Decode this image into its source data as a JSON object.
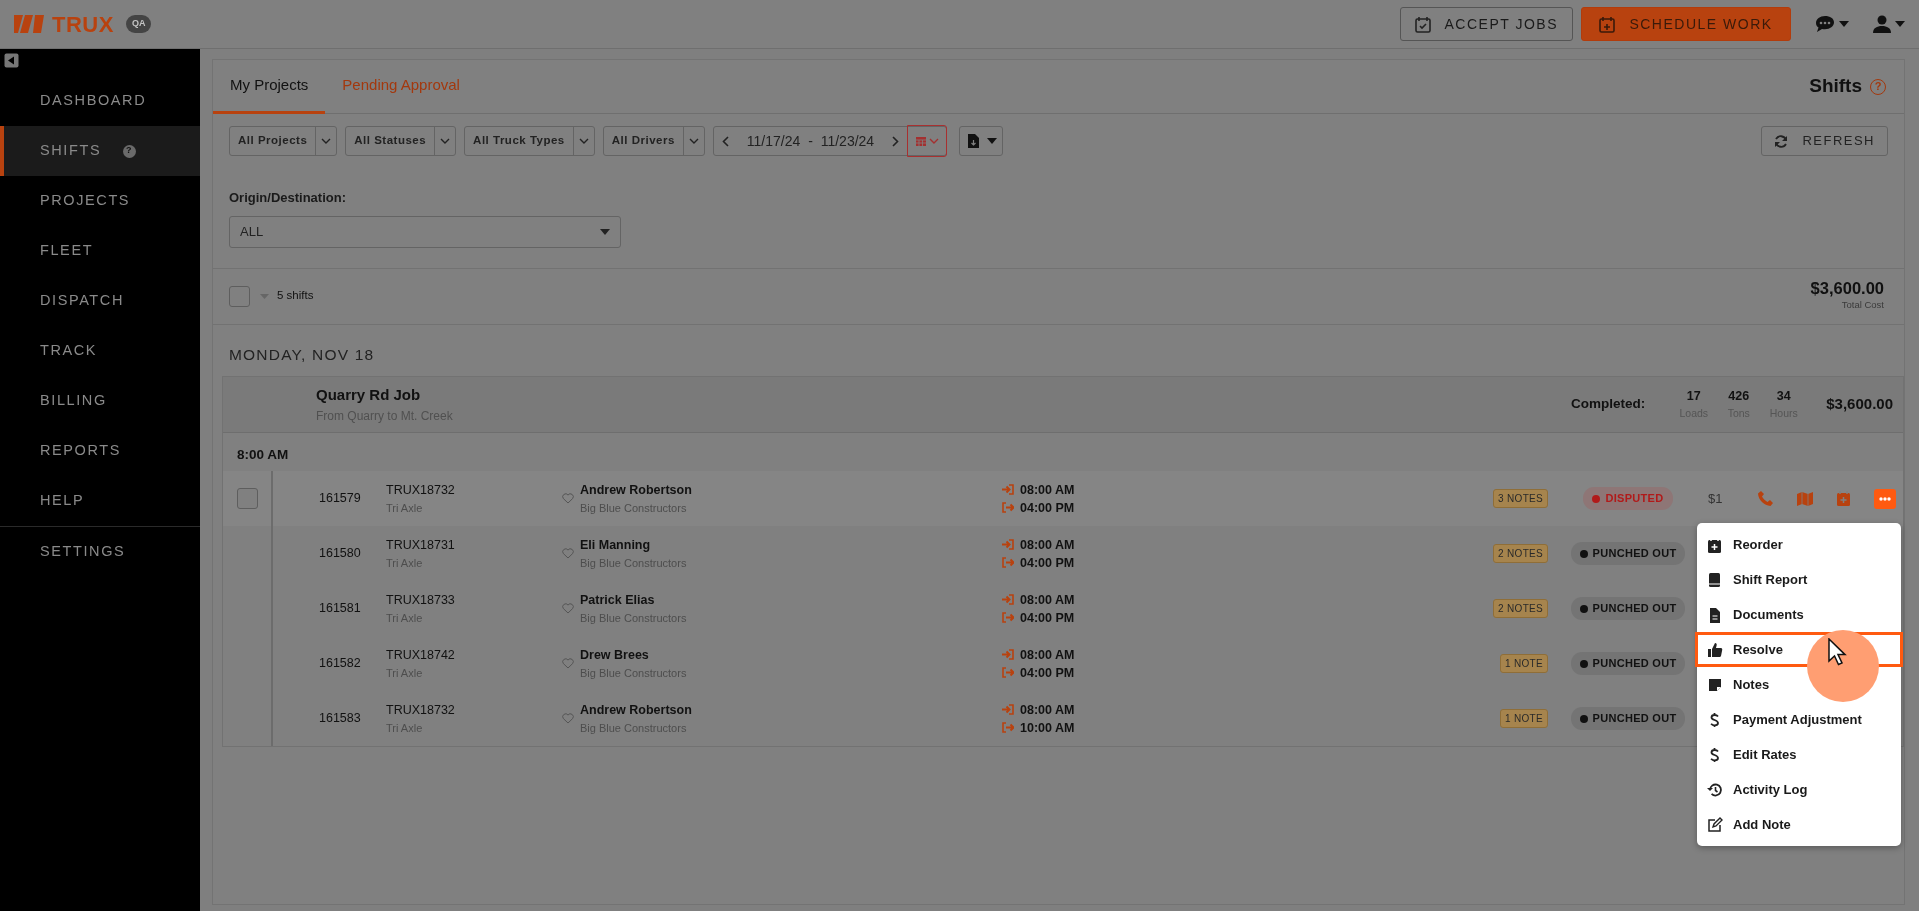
{
  "app": {
    "logo": "TRUX",
    "env_badge": "QA"
  },
  "header_buttons": [
    {
      "label": "ACCEPT JOBS",
      "kind": "outline"
    },
    {
      "label": "SCHEDULE WORK",
      "kind": "primary"
    }
  ],
  "sidebar": {
    "items": [
      {
        "label": "DASHBOARD",
        "selected": false
      },
      {
        "label": "SHIFTS",
        "selected": true,
        "badge": "?"
      },
      {
        "label": "PROJECTS",
        "selected": false
      },
      {
        "label": "FLEET",
        "selected": false
      },
      {
        "label": "DISPATCH",
        "selected": false
      },
      {
        "label": "TRACK",
        "selected": false
      },
      {
        "label": "BILLING",
        "selected": false
      },
      {
        "label": "REPORTS",
        "selected": false
      },
      {
        "label": "HELP",
        "selected": false
      },
      {
        "label": "SETTINGS",
        "selected": false
      }
    ]
  },
  "tabs": [
    {
      "label": "My Projects",
      "selected": true
    },
    {
      "label": "Pending Approval",
      "selected": false
    }
  ],
  "page_title": {
    "text": "Shifts",
    "help": "?"
  },
  "filters": [
    "All Projects",
    "All Statuses",
    "All Truck Types",
    "All Drivers"
  ],
  "date_range": "11/17/24 - 11/23/24",
  "refresh": "REFRESH",
  "origin": {
    "label": "Origin/Destination:",
    "value": "ALL"
  },
  "summary": {
    "checked": false,
    "count": "5 shifts",
    "total": "$3,600.00",
    "total_label": "Total Cost"
  },
  "day": "MONDAY, NOV 18",
  "job": {
    "title": "Quarry Rd Job",
    "subtitle": "From Quarry to Mt. Creek",
    "completed_label": "Completed:",
    "stats": [
      {
        "value": "17",
        "label": "Loads"
      },
      {
        "value": "426",
        "label": "Tons"
      },
      {
        "value": "34",
        "label": "Hours"
      }
    ],
    "total": "$3,600.00"
  },
  "time_group": "8:00 AM",
  "shifts": [
    {
      "id": "161579",
      "truck": "TRUX18732",
      "truck_type": "Tri Axle",
      "driver": "Andrew Robertson",
      "company": "Big Blue Constructors",
      "start": "08:00 AM",
      "end": "04:00 PM",
      "notes": "3 NOTES",
      "status": "DISPUTED",
      "kind": "disputed",
      "hovered": true,
      "cost": "$1"
    },
    {
      "id": "161580",
      "truck": "TRUX18731",
      "truck_type": "Tri Axle",
      "driver": "Eli Manning",
      "company": "Big Blue Constructors",
      "start": "08:00 AM",
      "end": "04:00 PM",
      "notes": "2 NOTES",
      "status": "PUNCHED OUT",
      "kind": "punched_out",
      "hovered": false
    },
    {
      "id": "161581",
      "truck": "TRUX18733",
      "truck_type": "Tri Axle",
      "driver": "Patrick Elias",
      "company": "Big Blue Constructors",
      "start": "08:00 AM",
      "end": "04:00 PM",
      "notes": "2 NOTES",
      "status": "PUNCHED OUT",
      "kind": "punched_out",
      "hovered": false
    },
    {
      "id": "161582",
      "truck": "TRUX18742",
      "truck_type": "Tri Axle",
      "driver": "Drew Brees",
      "company": "Big Blue Constructors",
      "start": "08:00 AM",
      "end": "04:00 PM",
      "notes": "1 NOTE",
      "status": "PUNCHED OUT",
      "kind": "punched_out",
      "hovered": false
    },
    {
      "id": "161583",
      "truck": "TRUX18732",
      "truck_type": "Tri Axle",
      "driver": "Andrew Robertson",
      "company": "Big Blue Constructors",
      "start": "08:00 AM",
      "end": "10:00 AM",
      "notes": "1 NOTE",
      "status": "PUNCHED OUT",
      "kind": "punched_out",
      "hovered": false
    }
  ],
  "menu": [
    {
      "label": "Reorder",
      "selected": false
    },
    {
      "label": "Shift Report",
      "selected": false
    },
    {
      "label": "Documents",
      "selected": false
    },
    {
      "label": "Resolve",
      "selected": true
    },
    {
      "label": "Notes",
      "selected": false
    },
    {
      "label": "Payment Adjustment",
      "selected": false
    },
    {
      "label": "Edit Rates",
      "selected": false
    },
    {
      "label": "Activity Log",
      "selected": false
    },
    {
      "label": "Add Note",
      "selected": false
    }
  ]
}
